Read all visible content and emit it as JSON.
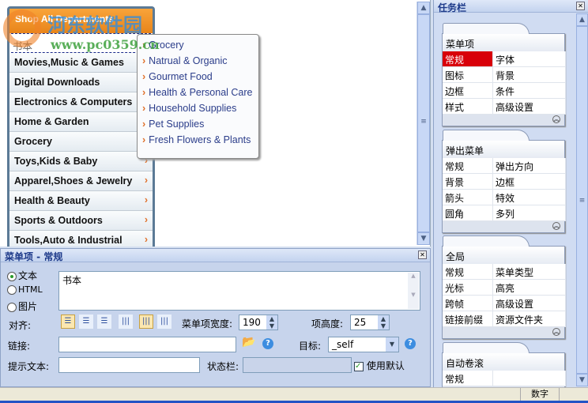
{
  "watermark": {
    "name": "河东软件园",
    "url": "www.pc0359.cn"
  },
  "menu": {
    "header": "Shop All Departments",
    "selected_item": "书本",
    "items": [
      "Movies,Music & Games",
      "Digital Downloads",
      "Electronics & Computers",
      "Home & Garden",
      "Grocery",
      "Toys,Kids & Baby",
      "Apparel,Shoes & Jewelry",
      "Health & Beauty",
      "Sports & Outdoors",
      "Tools,Auto & Industrial"
    ],
    "arrow_from_index": 5
  },
  "submenu": {
    "items": [
      "Grocery",
      "Natrual & Organic",
      "Gourmet Food",
      "Health & Personal Care",
      "Household Supplies",
      "Pet Supplies",
      "Fresh Flowers & Plants"
    ]
  },
  "props": {
    "title": "菜单项 - 常规",
    "radios": [
      {
        "label": "文本",
        "checked": true
      },
      {
        "label": "HTML",
        "checked": false
      },
      {
        "label": "图片",
        "checked": false
      }
    ],
    "text_value": "书本",
    "align_label": "对齐:",
    "width_label": "菜单项宽度:",
    "width_value": "190",
    "height_label": "项高度:",
    "height_value": "25",
    "link_label": "链接:",
    "link_value": "",
    "target_label": "目标:",
    "target_value": "_self",
    "tooltip_label": "提示文本:",
    "tooltip_value": "",
    "statusbar_label": "状态栏:",
    "statusbar_value": "",
    "use_default_label": "使用默认",
    "use_default_checked": true
  },
  "status": {
    "num": "数字"
  },
  "task": {
    "title": "任务栏",
    "groups": [
      {
        "title": "菜单项",
        "items": [
          "常规",
          "字体",
          "图标",
          "背景",
          "边框",
          "条件",
          "样式",
          "高级设置"
        ],
        "active": "常规"
      },
      {
        "title": "弹出菜单",
        "items": [
          "常规",
          "弹出方向",
          "背景",
          "边框",
          "箭头",
          "特效",
          "圆角",
          "多列"
        ]
      },
      {
        "title": "全局",
        "items": [
          "常规",
          "菜单类型",
          "光标",
          "高亮",
          "跨帧",
          "高级设置",
          "链接前缀",
          "资源文件夹"
        ]
      },
      {
        "title": "自动卷滚",
        "items": [
          "常规",
          ""
        ]
      }
    ]
  },
  "colors": {
    "accent_orange": "#f09a2e",
    "active_red": "#d8000a",
    "link_blue": "#2b3d8a"
  }
}
